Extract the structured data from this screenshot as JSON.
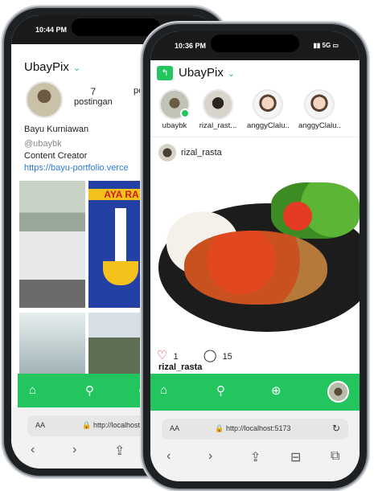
{
  "back_phone": {
    "status_time": "10:44 PM",
    "header_title": "UbayPix",
    "stats": [
      {
        "number": "7",
        "label": "postingan"
      },
      {
        "number": "",
        "label": "pe"
      }
    ],
    "name": "Bayu Kurniawan",
    "handle": "@ubaybk",
    "bio": "Content Creator",
    "link": "https://bayu-portfolio.verce",
    "grid_tile_text": "AYA RA",
    "url": "http://localhost"
  },
  "front_phone": {
    "status_time": "10:36 PM",
    "status_signal": "5G",
    "header_title": "UbayPix",
    "stories": [
      {
        "name": "ubaybk"
      },
      {
        "name": "rizal_rast..."
      },
      {
        "name": "anggyClalu..."
      },
      {
        "name": "anggyClalu..."
      }
    ],
    "post_username": "rizal_rasta",
    "likes": "1",
    "comments": "15",
    "caption_user": "rizal_rasta",
    "url": "http://localhost:5173"
  },
  "colors": {
    "accent": "#22c55e",
    "frame": "#1e2124"
  }
}
